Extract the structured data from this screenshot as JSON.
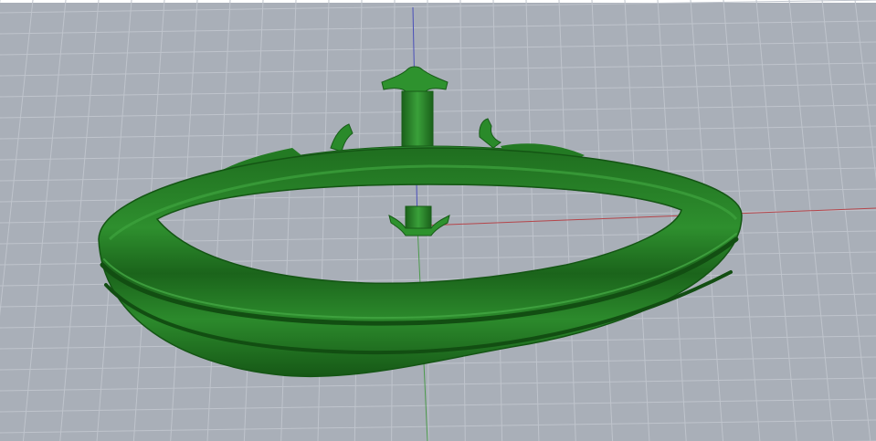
{
  "viewport": {
    "view": "perspective",
    "background_color": "#a9afb8",
    "grid_line_color": "#bfc4cc",
    "grid_major_color": "#c8ccd3",
    "axes": {
      "x_axis_color": "#b5454a",
      "y_axis_color": "#4c9a4c",
      "z_axis_color": "#4a4fb8"
    }
  },
  "model": {
    "object": "ring",
    "shaded_color": "#2b8a2b",
    "dark_color": "#145d14",
    "highlight_color": "#4fae4f",
    "grooves": 2,
    "prongs": 4
  }
}
